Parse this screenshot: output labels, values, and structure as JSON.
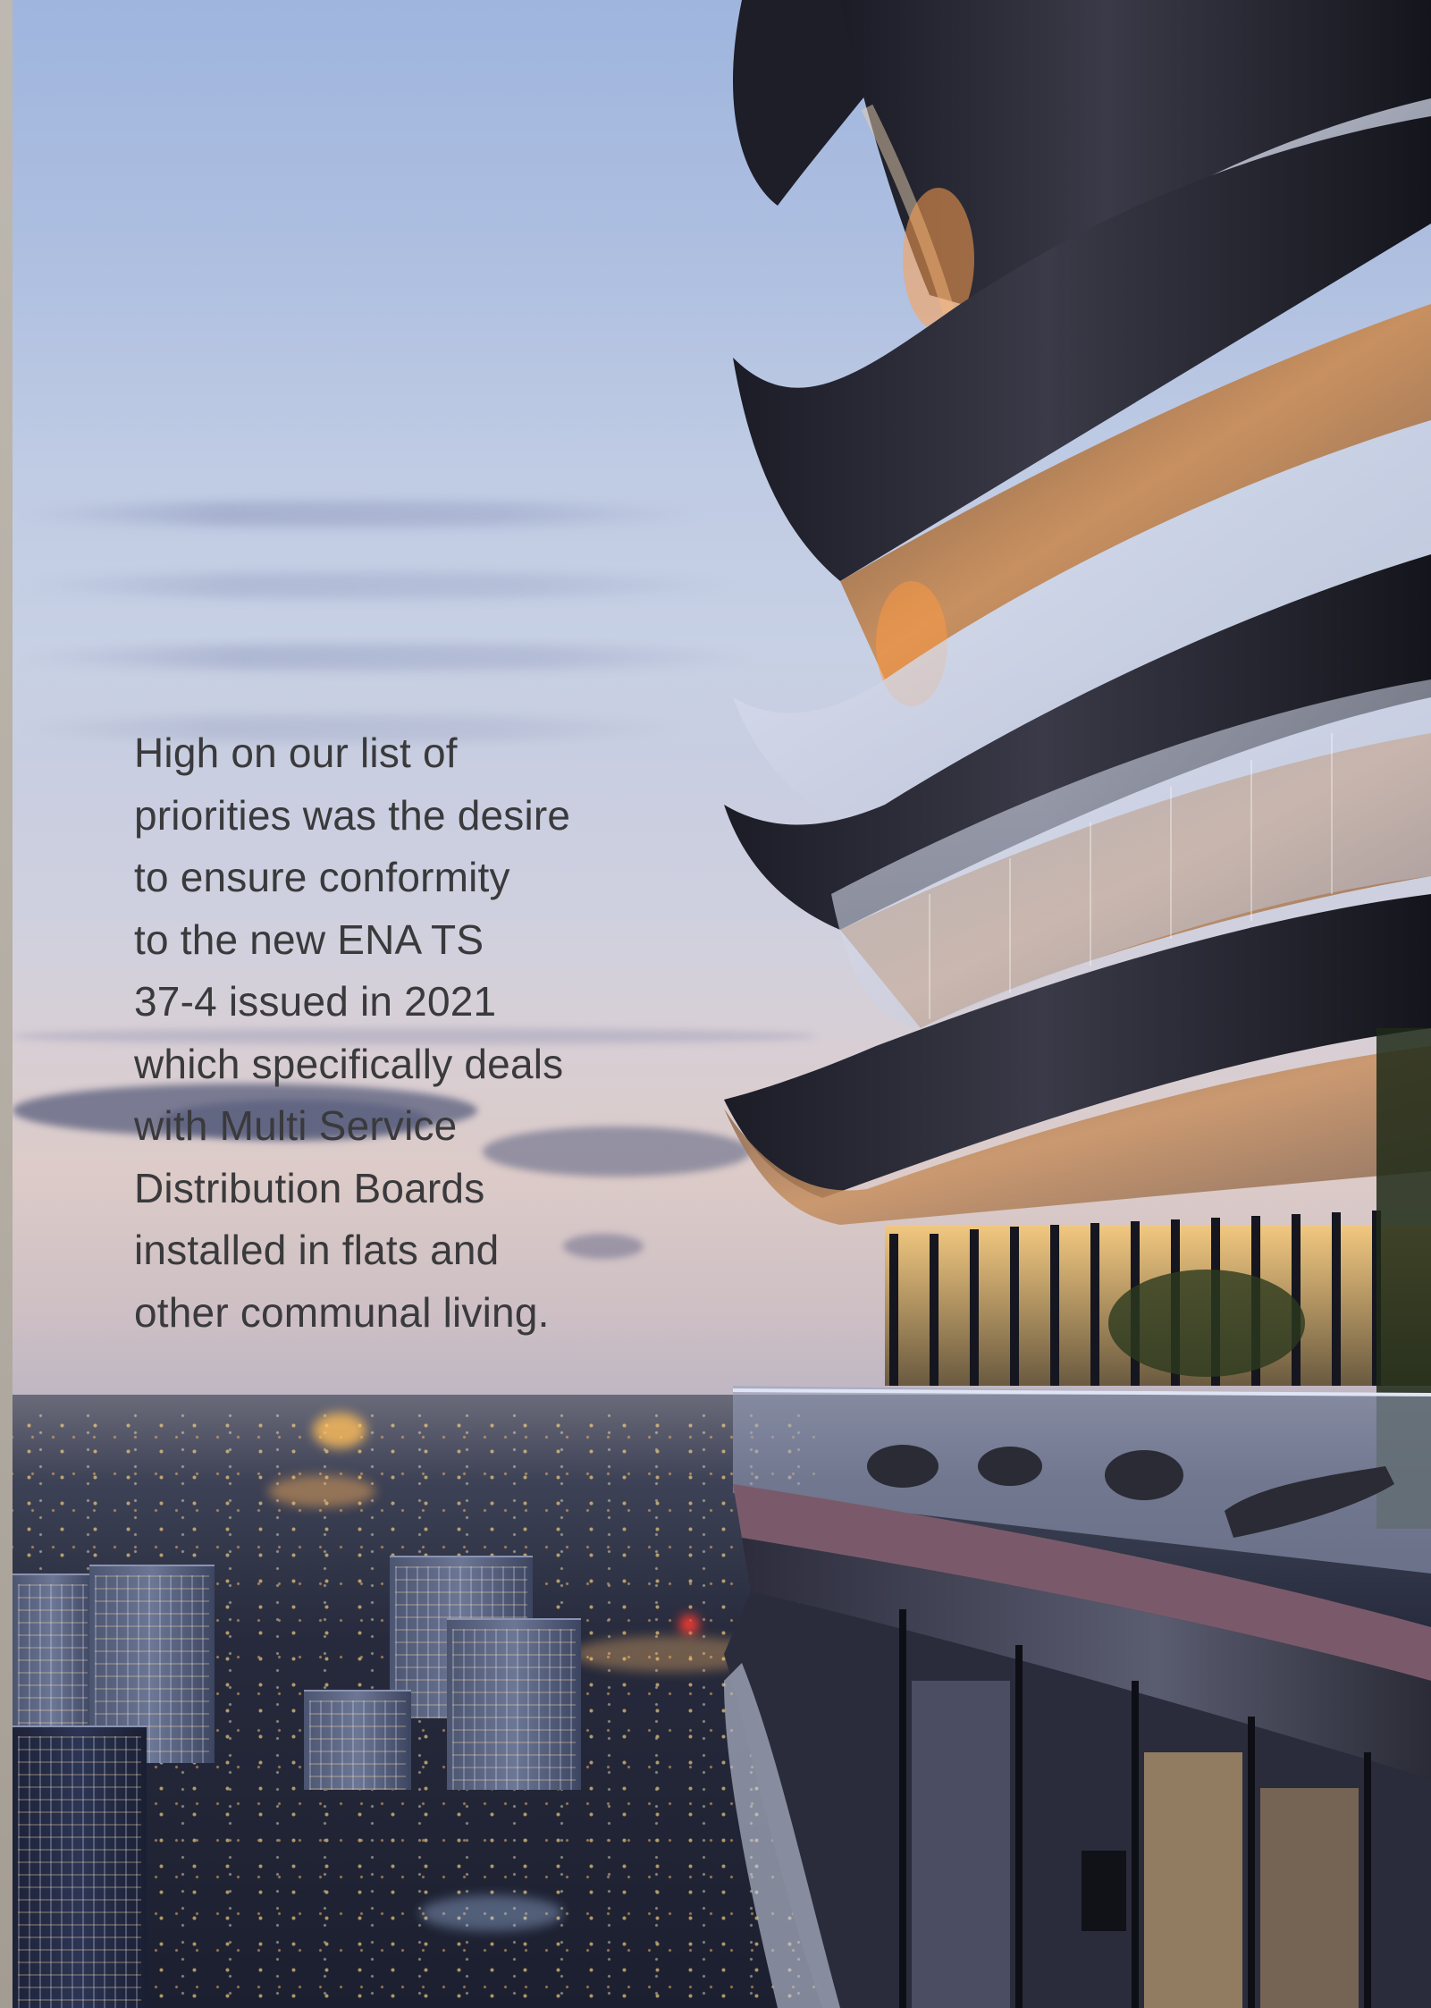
{
  "body": {
    "lines": [
      "High on our list of",
      "priorities was the desire",
      "to ensure conformity",
      "to the new ENA TS",
      "37-4 issued in 2021",
      "which specifically deals",
      "with Multi Service",
      "Distribution Boards",
      "installed in flats and",
      "other communal living."
    ]
  },
  "colors": {
    "text": "#3a3a3c",
    "sky_top": "#9fb5de",
    "sky_horizon": "#dccbc8",
    "city_dark": "#1b1f2f",
    "warm_light": "#ffb45a"
  }
}
